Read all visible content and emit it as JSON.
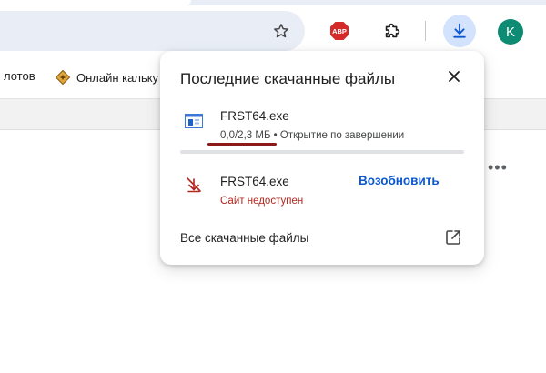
{
  "toolbar": {
    "avatar_letter": "K",
    "abp_label": "ABP"
  },
  "bookmarks": {
    "items": [
      {
        "label": "лотов"
      },
      {
        "label": "Онлайн кальку"
      }
    ]
  },
  "downloads": {
    "title": "Последние скачанные файлы",
    "items": [
      {
        "filename": "FRST64.exe",
        "status": "0,0/2,3 МБ • Открытие по завершении",
        "progress": 0
      },
      {
        "filename": "FRST64.exe",
        "status": "Сайт недоступен",
        "action": "Возобновить"
      }
    ],
    "all_downloads_label": "Все скачанные файлы"
  },
  "colors": {
    "accent": "#0b57d0",
    "error": "#b3261e",
    "download_button_bg": "#d3e3fd",
    "avatar_bg": "#0d8b73"
  }
}
